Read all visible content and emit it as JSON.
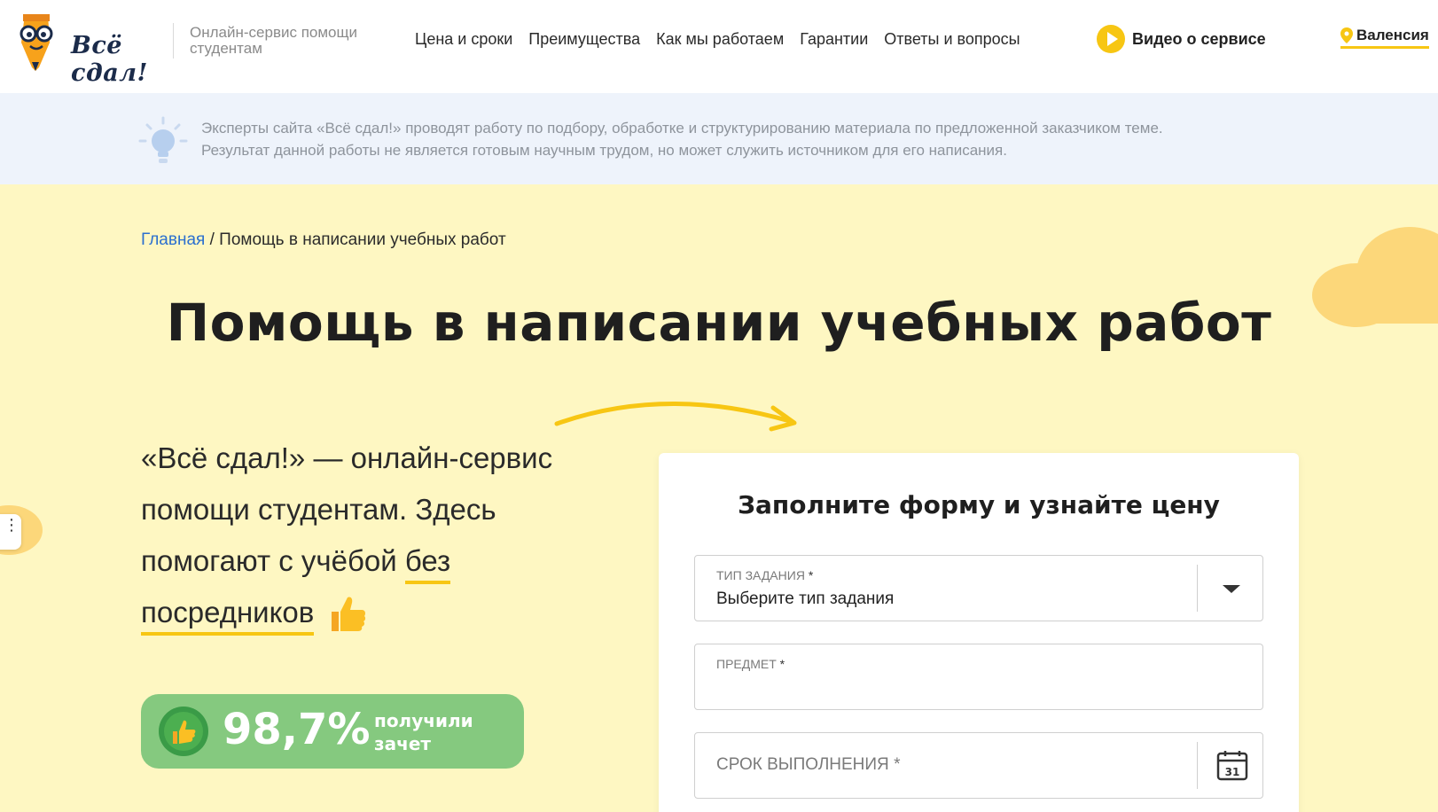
{
  "header": {
    "logo_text": "Всё сдал!",
    "tagline": "Онлайн-сервис помощи студентам",
    "nav": [
      "Цена и сроки",
      "Преимущества",
      "Как мы работаем",
      "Гарантии",
      "Ответы и вопросы"
    ],
    "video_label": "Видео о сервисе",
    "city": "Валенсия"
  },
  "notice": {
    "line1": "Эксперты сайта «Всё сдал!» проводят работу по подбору, обработке и структурированию материала по предложенной заказчиком теме.",
    "line2": "Результат данной работы не является готовым научным трудом, но может служить источником для его написания."
  },
  "breadcrumb": {
    "home": "Главная",
    "separator": "/",
    "current": "Помощь в написании учебных работ"
  },
  "hero": {
    "title": "Помощь в написании учебных работ",
    "intro_main": "«Всё сдал!» — онлайн-сервис помощи студентам. Здесь помогают с учёбой",
    "intro_underlined": "без посредников",
    "badge_percent": "98,7%",
    "badge_line1": "получили",
    "badge_line2": "зачет"
  },
  "form": {
    "title": "Заполните форму и узнайте цену",
    "task_type_label": "Тип задания",
    "task_type_value": "Выберите тип задания",
    "subject_label": "Предмет",
    "deadline_label": "Срок выполнения",
    "required_mark": "*",
    "calendar_day": "31"
  },
  "colors": {
    "accent": "#f7c613",
    "hero_bg": "#fef7c2",
    "notice_bg": "#eef3fb",
    "badge_bg": "#85c97f",
    "link": "#2b6fcf"
  }
}
